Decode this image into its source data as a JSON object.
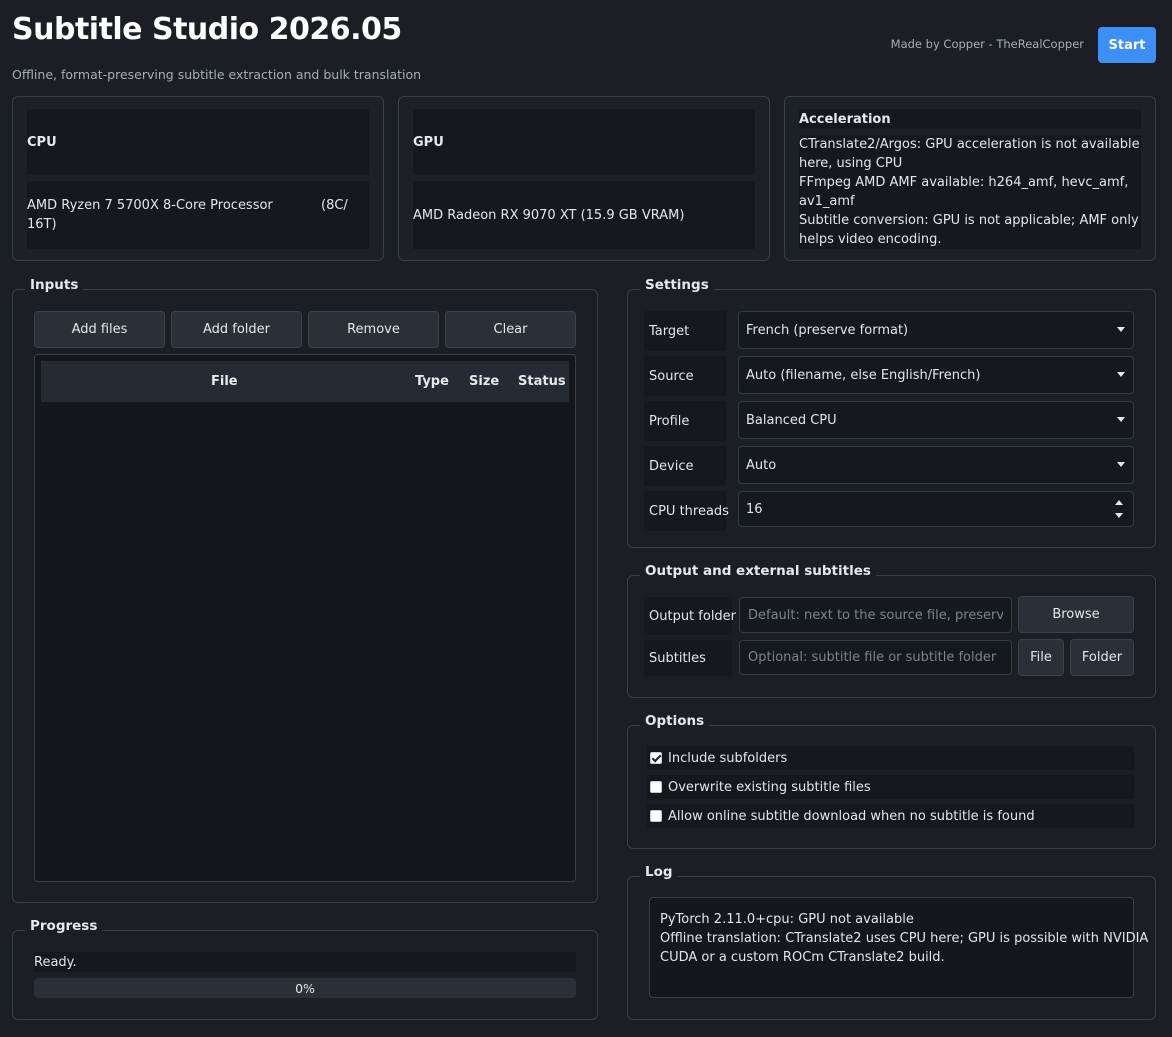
{
  "header": {
    "title": "Subtitle Studio 2026.05",
    "subtitle": "Offline, format-preserving subtitle extraction and bulk translation",
    "credit": "Made by Copper - TheRealCopper",
    "start_label": "Start"
  },
  "hardware": {
    "cpu": {
      "label": "CPU",
      "value": "AMD Ryzen 7 5700X 8-Core Processor",
      "cores": "(8C/",
      "threads": "16T)"
    },
    "gpu": {
      "label": "GPU",
      "value": "AMD Radeon RX 9070 XT (15.9 GB VRAM)"
    },
    "acceleration": {
      "label": "Acceleration",
      "lines": [
        "CTranslate2/Argos: GPU acceleration is not available",
        "here, using CPU",
        "FFmpeg AMD AMF available: h264_amf, hevc_amf,",
        "av1_amf",
        "Subtitle conversion: GPU is not applicable; AMF only",
        "helps video encoding."
      ]
    }
  },
  "inputs": {
    "title": "Inputs",
    "buttons": {
      "add_files": "Add files",
      "add_folder": "Add folder",
      "remove": "Remove",
      "clear": "Clear"
    },
    "columns": {
      "file": "File",
      "type": "Type",
      "size": "Size",
      "status": "Status"
    }
  },
  "progress": {
    "title": "Progress",
    "status": "Ready.",
    "percent": 0,
    "percent_label": "0%"
  },
  "settings": {
    "title": "Settings",
    "target": {
      "label": "Target",
      "value": "French (preserve format)"
    },
    "source": {
      "label": "Source",
      "value": "Auto (filename, else English/French)"
    },
    "profile": {
      "label": "Profile",
      "value": "Balanced CPU"
    },
    "device": {
      "label": "Device",
      "value": "Auto"
    },
    "threads": {
      "label": "CPU threads",
      "value": "16"
    }
  },
  "output": {
    "title": "Output and external subtitles",
    "folder_label": "Output folder",
    "folder_placeholder": "Default: next to the source file, preservi...",
    "browse_label": "Browse",
    "subtitles_label": "Subtitles",
    "subtitles_placeholder": "Optional: subtitle file or subtitle folder",
    "file_label": "File",
    "folder_button": "Folder"
  },
  "options": {
    "title": "Options",
    "include_subfolders": {
      "label": "Include subfolders",
      "checked": true
    },
    "overwrite": {
      "label": "Overwrite existing subtitle files",
      "checked": false
    },
    "online_download": {
      "label": "Allow online subtitle download when no subtitle is found",
      "checked": false
    }
  },
  "log": {
    "title": "Log",
    "lines": [
      "PyTorch 2.11.0+cpu: GPU not available",
      "Offline translation: CTranslate2 uses CPU here; GPU is possible with NVIDIA",
      "CUDA or a custom ROCm CTranslate2 build."
    ]
  }
}
